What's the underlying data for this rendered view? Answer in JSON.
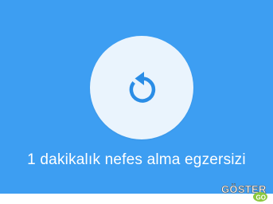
{
  "screen": {
    "caption": "1 dakikalık nefes alma egzersizi",
    "replay_icon": "replay-icon",
    "watermark_text": "GÖSTER",
    "watermark_badge": "GO"
  },
  "colors": {
    "card_background": "#3d9ef2",
    "circle_background": "#eaf4fd",
    "icon": "#2a8de6",
    "caption_text": "#ffffff",
    "watermark_badge": "#8bc83f"
  }
}
